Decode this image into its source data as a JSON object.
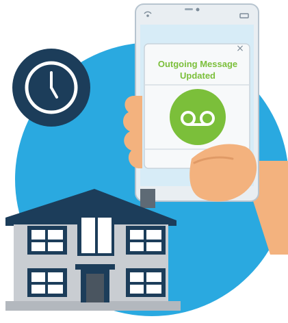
{
  "popup": {
    "title": "Outgoing Message Updated",
    "close_symbol": "×"
  },
  "icons": {
    "clock": "clock-icon",
    "voicemail": "voicemail-icon",
    "signal": "signal-icon",
    "battery": "battery-icon"
  },
  "colors": {
    "background_circle": "#2aa9e0",
    "clock_badge": "#1c3d5a",
    "phone_screen": "#d7ecf7",
    "accent_green": "#7bbf3a",
    "skin": "#f3b27e",
    "house_wall": "#c9cdd2",
    "house_roof": "#1c3d5a"
  }
}
